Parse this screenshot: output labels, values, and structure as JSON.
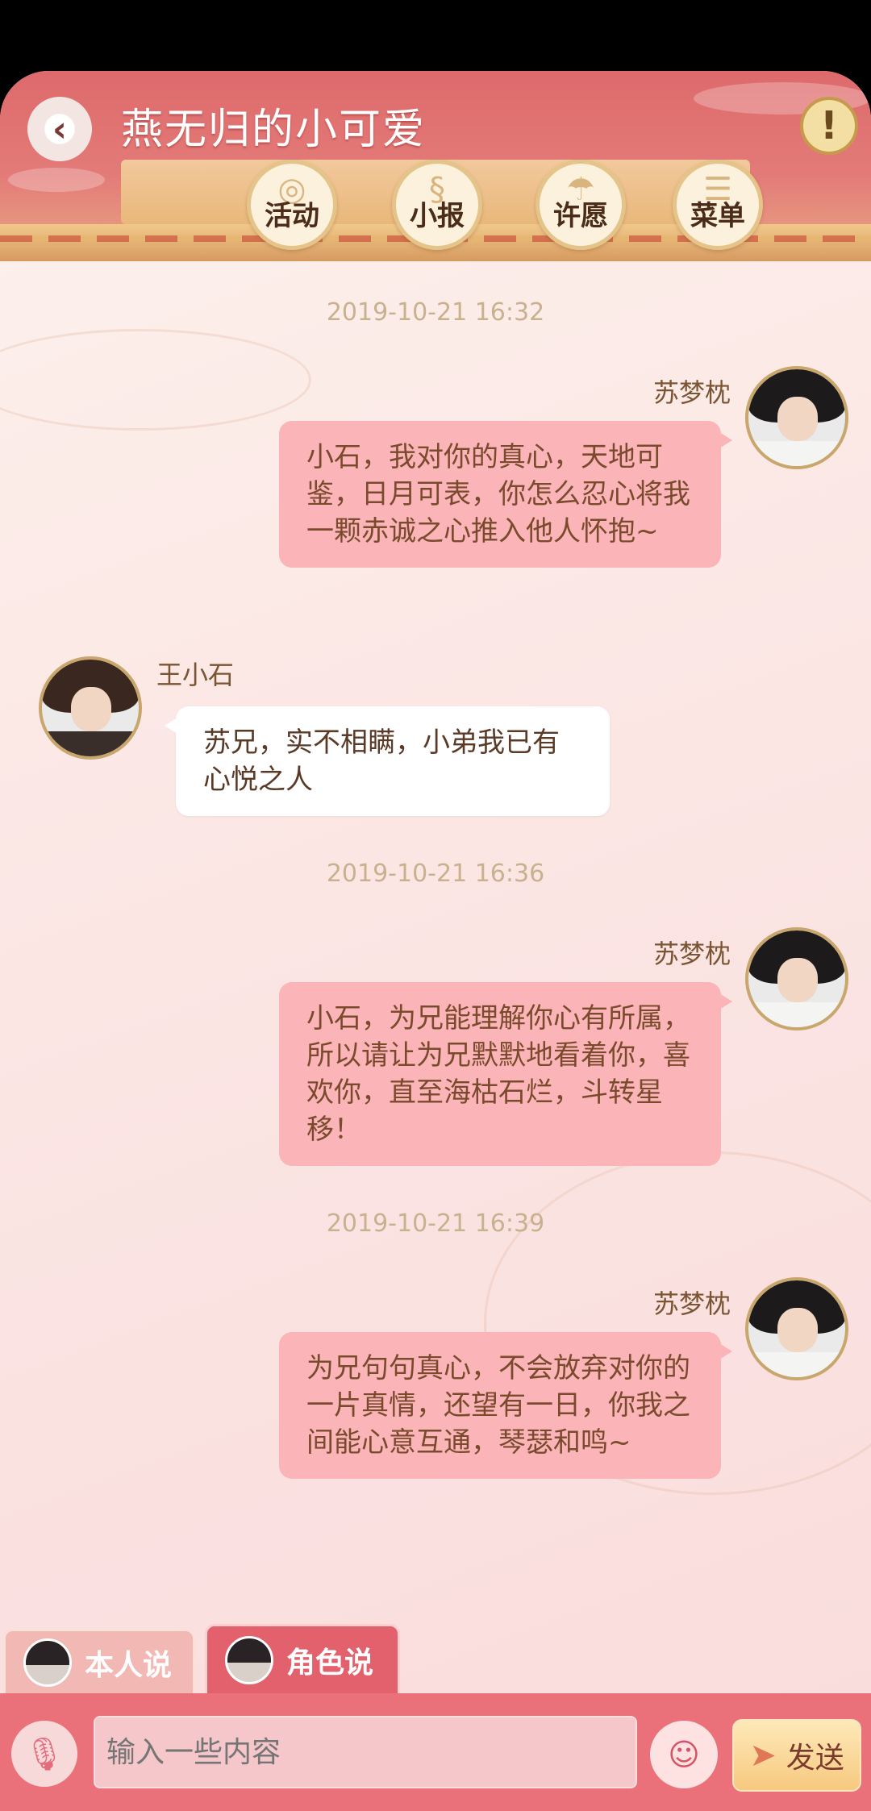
{
  "header": {
    "title": "燕无归的小可爱",
    "back_icon": "chevron-left-icon",
    "alert_label": "!",
    "nav": [
      {
        "label": "活动",
        "icon": "lantern-icon"
      },
      {
        "label": "小报",
        "icon": "scroll-icon"
      },
      {
        "label": "许愿",
        "icon": "fountain-icon"
      },
      {
        "label": "菜单",
        "icon": "menu-icon"
      }
    ]
  },
  "messages": [
    {
      "timestamp": "2019-10-21 16:32"
    },
    {
      "sender": "苏梦枕",
      "side": "right",
      "text": "小石，我对你的真心，天地可鉴，日月可表，你怎么忍心将我一颗赤诚之心推入他人怀抱~"
    },
    {
      "sender": "王小石",
      "side": "left",
      "text": "苏兄，实不相瞒，小弟我已有心悦之人"
    },
    {
      "timestamp": "2019-10-21 16:36"
    },
    {
      "sender": "苏梦枕",
      "side": "right",
      "text": "小石，为兄能理解你心有所属，所以请让为兄默默地看着你，喜欢你，直至海枯石烂，斗转星移！"
    },
    {
      "timestamp": "2019-10-21 16:39"
    },
    {
      "sender": "苏梦枕",
      "side": "right",
      "text": "为兄句句真心，不会放弃对你的一片真情，还望有一日，你我之间能心意互通，琴瑟和鸣~"
    }
  ],
  "mode_tabs": [
    {
      "label": "本人说",
      "selected": false
    },
    {
      "label": "角色说",
      "selected": true
    }
  ],
  "input": {
    "placeholder": "输入一些内容",
    "send_label": "发送"
  },
  "colors": {
    "header": "#de6a6c",
    "bubble_right": "#fbb4b8",
    "input_bar": "#ea707a"
  }
}
